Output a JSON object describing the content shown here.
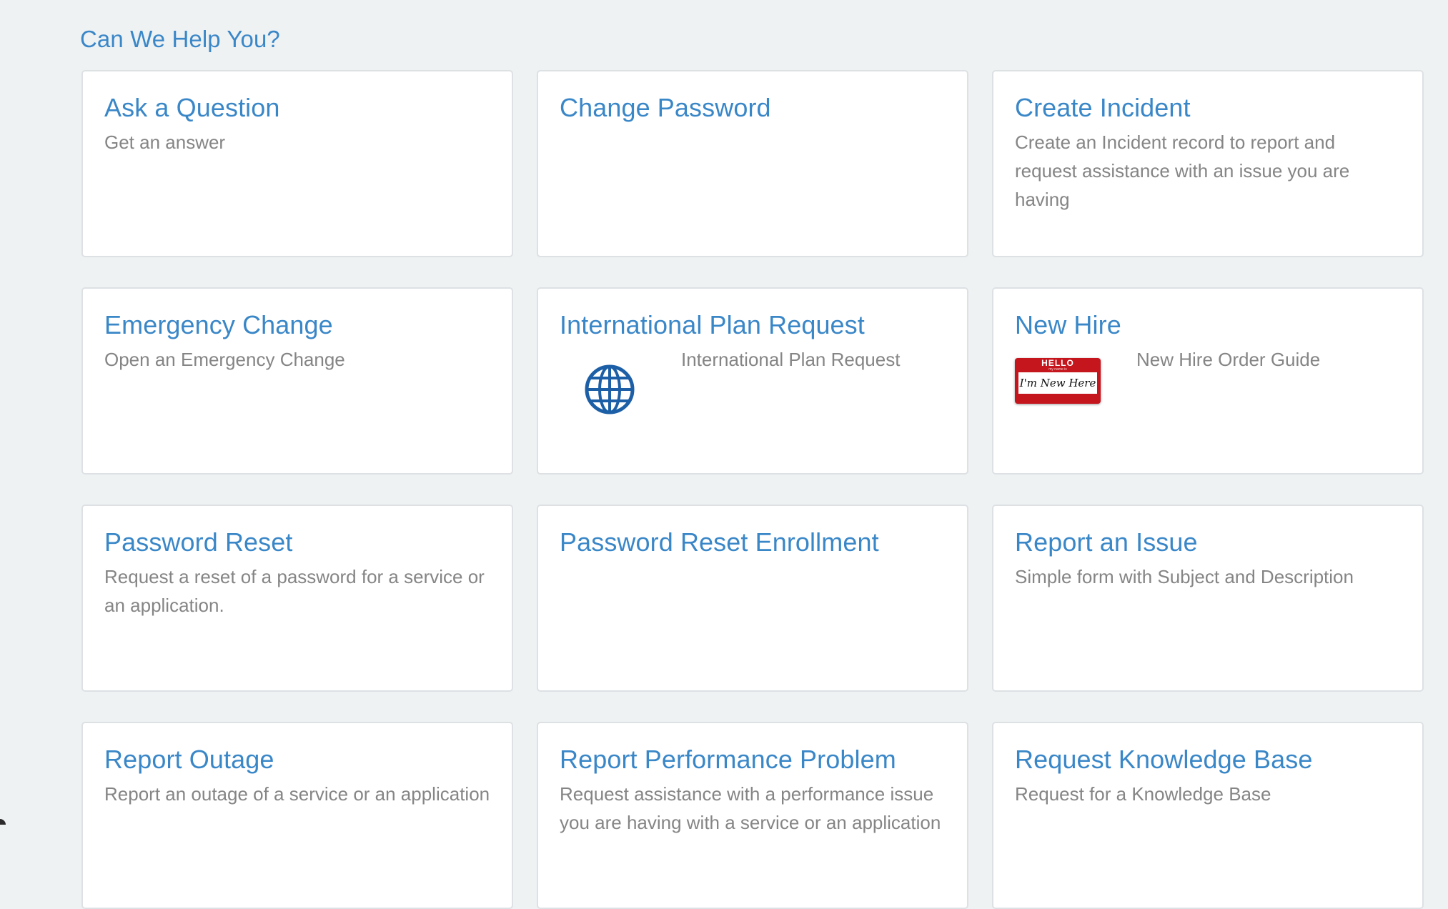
{
  "section": {
    "title": "Can We Help You?"
  },
  "cards": [
    {
      "title": "Ask a Question",
      "description": "Get an answer"
    },
    {
      "title": "Change Password",
      "description": ""
    },
    {
      "title": "Create Incident",
      "description": "Create an Incident record to report and request assistance with an issue you are having"
    },
    {
      "title": "Emergency Change",
      "description": "Open an Emergency Change"
    },
    {
      "title": "International Plan Request",
      "description": "International Plan Request",
      "icon": "globe-icon"
    },
    {
      "title": "New Hire",
      "description": "New Hire Order Guide",
      "icon": "name-tag-badge",
      "badge_text": {
        "hello": "HELLO",
        "sub": "my name is",
        "name": "I'm New Here"
      }
    },
    {
      "title": "Password Reset",
      "description": "Request a reset of a password for a service or an application."
    },
    {
      "title": "Password Reset Enrollment",
      "description": ""
    },
    {
      "title": "Report an Issue",
      "description": "Simple form with Subject and Description"
    },
    {
      "title": "Report Outage",
      "description": "Report an outage of a service or an application"
    },
    {
      "title": "Report Performance Problem",
      "description": "Request assistance with a performance issue you are having with a service or an application"
    },
    {
      "title": "Request Knowledge Base",
      "description": "Request for a Knowledge Base"
    }
  ],
  "colors": {
    "background": "#eff2f3",
    "link": "#3a87c8",
    "description": "#858585",
    "card_border": "#dde1e4",
    "badge_red": "#c5161d",
    "globe_blue": "#1d5fa6"
  }
}
